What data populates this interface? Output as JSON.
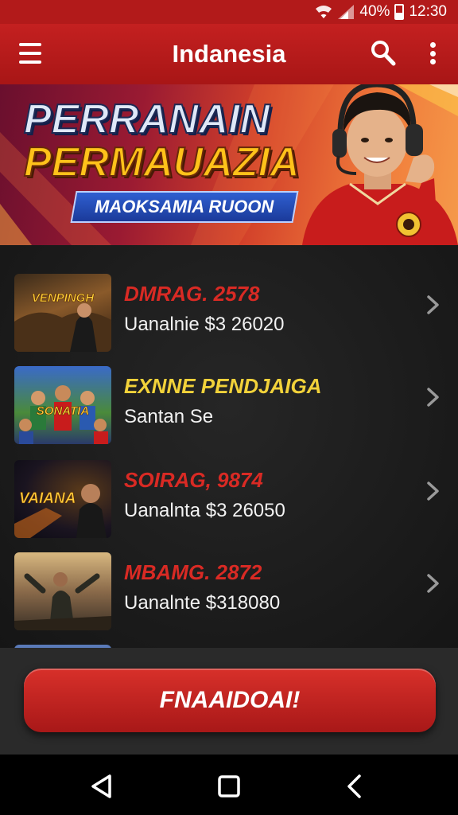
{
  "status_bar": {
    "battery": "40%",
    "time": "12:30"
  },
  "app_bar": {
    "title": "Indanesia",
    "menu_icon": "hamburger-icon",
    "search_icon": "search-icon",
    "more_icon": "more-vert-icon"
  },
  "banner": {
    "line1": "PERRANAIN",
    "line2": "PERMAUAZIA",
    "pill": "MAOKSAMIA RUOON",
    "colors": {
      "line1": "#dfe8f8",
      "line2": "#ffc21a",
      "pill": "#2f5fd0"
    }
  },
  "items": [
    {
      "title": "DMRAG. 2578",
      "subtitle": "Uanalnie $3 26020",
      "title_color": "#d92a24",
      "thumb_caption": "VENPINGH"
    },
    {
      "title": "EXNNE PENDJAIGA",
      "subtitle": "Santan Se",
      "title_color": "#f2d23a",
      "thumb_caption": "SONATIA"
    },
    {
      "title": "SOIRAG, 9874",
      "subtitle": "Uanalnta $3 26050",
      "title_color": "#d92a24",
      "thumb_caption": "VAIANA"
    },
    {
      "title": "MBAMG. 2872",
      "subtitle": "Uanalnte $318080",
      "title_color": "#d92a24",
      "thumb_caption": ""
    }
  ],
  "cta": {
    "label": "FNAAIDOAI!",
    "color": "#d8302a"
  },
  "nav": {
    "back_icon": "back-triangle-icon",
    "home_icon": "home-square-icon",
    "recents_icon": "chevron-left-icon"
  }
}
